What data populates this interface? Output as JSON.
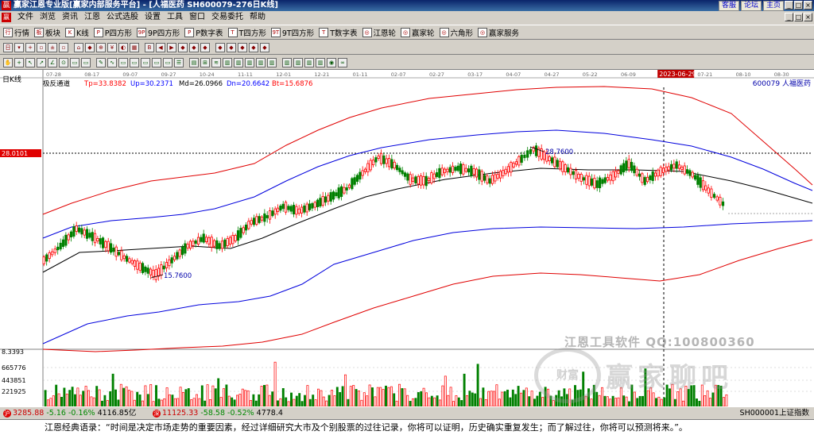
{
  "window": {
    "title": "赢家江恩专业版[赢家内部服务平台] - [人福医药  SH600079-276日K线]",
    "logo": "赢",
    "links": [
      "客服",
      "论坛",
      "主页"
    ],
    "controls": [
      "_",
      "□",
      "×"
    ]
  },
  "menu": {
    "icon": "赢",
    "items": [
      "文件",
      "浏览",
      "资讯",
      "江恩",
      "公式选股",
      "设置",
      "工具",
      "窗口",
      "交易委托",
      "帮助"
    ]
  },
  "toolbar1": [
    {
      "icon": "行",
      "label": "行情"
    },
    {
      "icon": "板",
      "label": "板块"
    },
    {
      "icon": "K",
      "label": "K线"
    },
    {
      "icon": "P",
      "label": "P四方形"
    },
    {
      "icon": "9P",
      "label": "9P四方形"
    },
    {
      "icon": "P",
      "label": "P数字表"
    },
    {
      "icon": "T",
      "label": "T四方形"
    },
    {
      "icon": "9T",
      "label": "9T四方形"
    },
    {
      "icon": "T",
      "label": "T数字表"
    },
    {
      "icon": "◎",
      "label": "江恩轮"
    },
    {
      "icon": "◎",
      "label": "赢家轮"
    },
    {
      "icon": "◎",
      "label": "六角形"
    },
    {
      "icon": "◎",
      "label": "赢家服务"
    }
  ],
  "toolbar2_icons": [
    "日",
    "▾",
    "+",
    "▫",
    "±",
    "▫",
    "⌂",
    "◆",
    "⊕",
    "¥",
    "◐",
    "▦",
    "B",
    "◀",
    "▶",
    "◆",
    "◆",
    "◆",
    "◆",
    "◆",
    "◆",
    "◆",
    "◆"
  ],
  "toolbar3_icons": [
    "✋",
    "+",
    "↖",
    "↗",
    "∠",
    "⊙",
    "▭",
    "▭",
    "✎",
    "∿",
    "▭",
    "▭",
    "▭",
    "▭",
    "▭",
    "☰",
    "▤",
    "⊞",
    "≋",
    "▥",
    "▥",
    "▥",
    "▥",
    "▥",
    "▥",
    "▥",
    "▥",
    "▥",
    "◉",
    "∞"
  ],
  "chart": {
    "panel_label": "日K线",
    "indicator_name": "极反通道",
    "indicator_values": [
      {
        "label": "Tp=33.8382",
        "color": "#ff0000"
      },
      {
        "label": "Up=30.2371",
        "color": "#0000ff"
      },
      {
        "label": "Md=26.0966",
        "color": "#000000"
      },
      {
        "label": "Dn=20.6642",
        "color": "#0000ff"
      },
      {
        "label": "Bt=15.6876",
        "color": "#ff0000"
      }
    ],
    "stock_label": "600079  人福医药",
    "date_labels": [
      "07-28",
      "08-17",
      "09-07",
      "09-27",
      "10-24",
      "11-11",
      "12-01",
      "12-21",
      "01-11",
      "02-07",
      "02-27",
      "03-17",
      "04-07",
      "04-27",
      "05-22",
      "06-09",
      "2023-06-29",
      "07-21",
      "08-10",
      "08-30"
    ],
    "current_date": "2023-06-29",
    "price_marker": "28.0101",
    "annot_high": "28.7600",
    "annot_low": "15.7600",
    "volume_scale": [
      "8.3393",
      "665776",
      "443851",
      "221925"
    ],
    "colors": {
      "up": "#ff0000",
      "down": "#008000",
      "top": "#e00000",
      "mid": "#000000",
      "band": "#0000dd"
    }
  },
  "status": {
    "sh_icon": "沪",
    "sh_index": "3285.88",
    "sh_change": "-5.16",
    "sh_pct": "-0.16%",
    "sh_amount": "4116.85亿",
    "sz_icon": "深",
    "sz_index": "11125.33",
    "sz_change": "-58.58",
    "sz_pct": "-0.52%",
    "sz_amount": "4778.4",
    "right_label": "SH000001上证指数"
  },
  "watermark": {
    "line1": "江恩工具软件  QQ:100800360",
    "line2": "赢家聊吧",
    "logo": "财富"
  },
  "quote": "江恩经典语录：“时间是决定市场走势的重要因素，经过详细研究大市及个别股票的过往记录，你将可以证明，历史确实重复发生；而了解过往，你将可以预测将来。”。"
}
